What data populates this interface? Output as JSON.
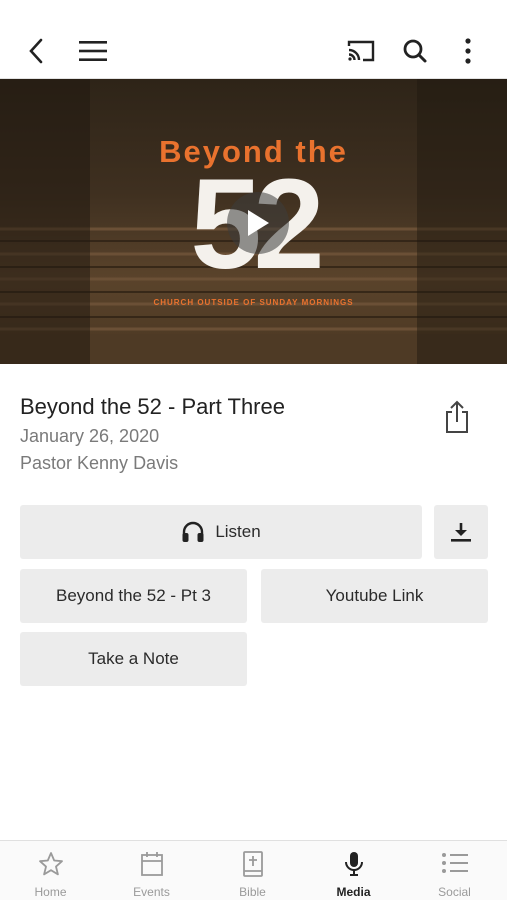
{
  "toolbar": {
    "back_icon": "chevron-left-icon",
    "menu_icon": "hamburger-icon",
    "cast_icon": "cast-icon",
    "search_icon": "search-icon",
    "more_icon": "more-vertical-icon"
  },
  "hero": {
    "title": "Beyond the",
    "number": "52",
    "subtitle": "CHURCH OUTSIDE OF SUNDAY MORNINGS",
    "play_icon": "play-icon",
    "accent_color": "#e9722e"
  },
  "sermon": {
    "title": "Beyond the 52 - Part Three",
    "date": "January 26, 2020",
    "speaker": "Pastor Kenny Davis",
    "share_icon": "share-icon"
  },
  "actions": {
    "listen_label": "Listen",
    "listen_icon": "headphones-icon",
    "download_icon": "download-icon",
    "part_label": "Beyond the 52 - Pt 3",
    "youtube_label": "Youtube Link",
    "note_label": "Take a Note"
  },
  "tabs": [
    {
      "label": "Home",
      "icon": "star-icon",
      "active": false
    },
    {
      "label": "Events",
      "icon": "calendar-icon",
      "active": false
    },
    {
      "label": "Bible",
      "icon": "bible-icon",
      "active": false
    },
    {
      "label": "Media",
      "icon": "microphone-icon",
      "active": true
    },
    {
      "label": "Social",
      "icon": "list-icon",
      "active": false
    }
  ]
}
